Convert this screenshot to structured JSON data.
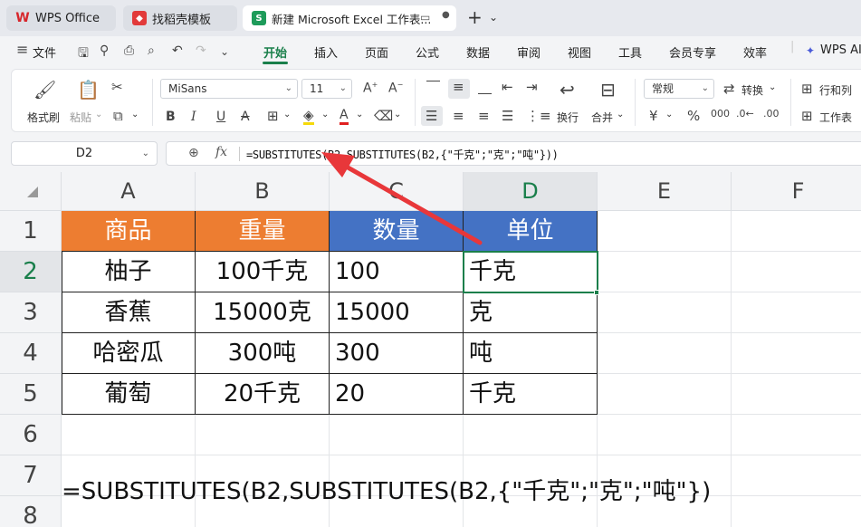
{
  "tabs": [
    {
      "label": "WPS Office",
      "icon": "wps-icon"
    },
    {
      "label": "找稻壳模板",
      "icon": "daoke-icon"
    },
    {
      "label": "新建 Microsoft Excel 工作表...",
      "icon": "spreadsheet-icon"
    }
  ],
  "menu": {
    "file": "文件",
    "items": [
      "开始",
      "插入",
      "页面",
      "公式",
      "数据",
      "审阅",
      "视图",
      "工具",
      "会员专享",
      "效率"
    ],
    "active": "开始",
    "ai": "WPS AI"
  },
  "ribbon": {
    "format_painter": "格式刷",
    "paste": "粘贴",
    "font_name": "MiSans",
    "font_size": "11",
    "wrap": "换行",
    "merge": "合并",
    "number_format": "常规",
    "convert": "转换",
    "row_col": "行和列",
    "worksheet": "工作表"
  },
  "formula_bar": {
    "name_box": "D2",
    "formula": "=SUBSTITUTES(B2,SUBSTITUTES(B2,{\"千克\";\"克\";\"吨\"}))"
  },
  "sheet": {
    "columns": [
      "A",
      "B",
      "C",
      "D",
      "E",
      "F"
    ],
    "rows": [
      "1",
      "2",
      "3",
      "4",
      "5",
      "6",
      "7",
      "8"
    ],
    "header": [
      "商品",
      "重量",
      "数量",
      "单位"
    ],
    "data": [
      [
        "柚子",
        "100千克",
        "100",
        "千克"
      ],
      [
        "香蕉",
        "15000克",
        "15000",
        "克"
      ],
      [
        "哈密瓜",
        "300吨",
        "300",
        "吨"
      ],
      [
        "葡萄",
        "20千克",
        "20",
        "千克"
      ]
    ],
    "formula_text": "=SUBSTITUTES(B2,SUBSTITUTES(B2,{\"千克\";\"克\";\"吨\"})",
    "active_cell": "D2"
  },
  "colors": {
    "header_orange": "#ed7d31",
    "header_blue": "#4472c4",
    "accent_green": "#1a7f4b",
    "arrow_red": "#e8373a"
  }
}
